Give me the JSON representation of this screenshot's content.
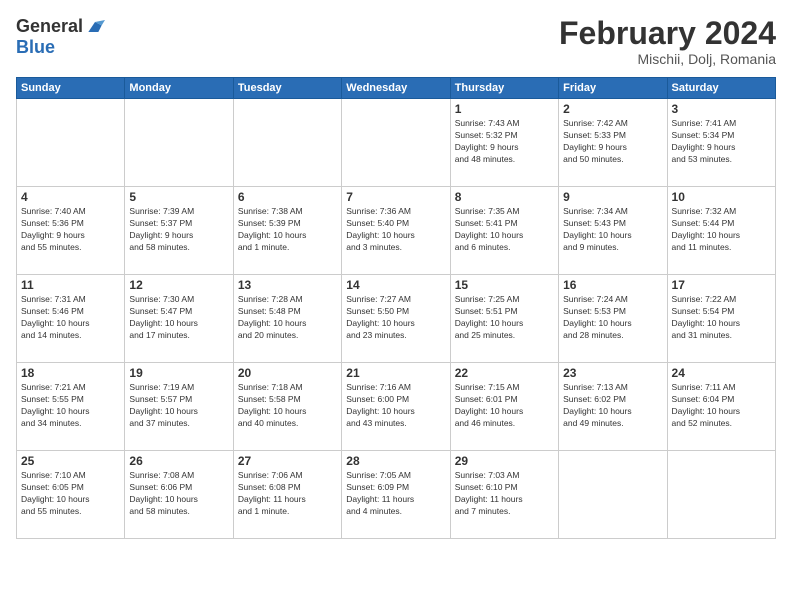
{
  "header": {
    "logo_general": "General",
    "logo_blue": "Blue",
    "title": "February 2024",
    "location": "Mischii, Dolj, Romania"
  },
  "weekdays": [
    "Sunday",
    "Monday",
    "Tuesday",
    "Wednesday",
    "Thursday",
    "Friday",
    "Saturday"
  ],
  "weeks": [
    [
      {
        "day": "",
        "info": ""
      },
      {
        "day": "",
        "info": ""
      },
      {
        "day": "",
        "info": ""
      },
      {
        "day": "",
        "info": ""
      },
      {
        "day": "1",
        "info": "Sunrise: 7:43 AM\nSunset: 5:32 PM\nDaylight: 9 hours\nand 48 minutes."
      },
      {
        "day": "2",
        "info": "Sunrise: 7:42 AM\nSunset: 5:33 PM\nDaylight: 9 hours\nand 50 minutes."
      },
      {
        "day": "3",
        "info": "Sunrise: 7:41 AM\nSunset: 5:34 PM\nDaylight: 9 hours\nand 53 minutes."
      }
    ],
    [
      {
        "day": "4",
        "info": "Sunrise: 7:40 AM\nSunset: 5:36 PM\nDaylight: 9 hours\nand 55 minutes."
      },
      {
        "day": "5",
        "info": "Sunrise: 7:39 AM\nSunset: 5:37 PM\nDaylight: 9 hours\nand 58 minutes."
      },
      {
        "day": "6",
        "info": "Sunrise: 7:38 AM\nSunset: 5:39 PM\nDaylight: 10 hours\nand 1 minute."
      },
      {
        "day": "7",
        "info": "Sunrise: 7:36 AM\nSunset: 5:40 PM\nDaylight: 10 hours\nand 3 minutes."
      },
      {
        "day": "8",
        "info": "Sunrise: 7:35 AM\nSunset: 5:41 PM\nDaylight: 10 hours\nand 6 minutes."
      },
      {
        "day": "9",
        "info": "Sunrise: 7:34 AM\nSunset: 5:43 PM\nDaylight: 10 hours\nand 9 minutes."
      },
      {
        "day": "10",
        "info": "Sunrise: 7:32 AM\nSunset: 5:44 PM\nDaylight: 10 hours\nand 11 minutes."
      }
    ],
    [
      {
        "day": "11",
        "info": "Sunrise: 7:31 AM\nSunset: 5:46 PM\nDaylight: 10 hours\nand 14 minutes."
      },
      {
        "day": "12",
        "info": "Sunrise: 7:30 AM\nSunset: 5:47 PM\nDaylight: 10 hours\nand 17 minutes."
      },
      {
        "day": "13",
        "info": "Sunrise: 7:28 AM\nSunset: 5:48 PM\nDaylight: 10 hours\nand 20 minutes."
      },
      {
        "day": "14",
        "info": "Sunrise: 7:27 AM\nSunset: 5:50 PM\nDaylight: 10 hours\nand 23 minutes."
      },
      {
        "day": "15",
        "info": "Sunrise: 7:25 AM\nSunset: 5:51 PM\nDaylight: 10 hours\nand 25 minutes."
      },
      {
        "day": "16",
        "info": "Sunrise: 7:24 AM\nSunset: 5:53 PM\nDaylight: 10 hours\nand 28 minutes."
      },
      {
        "day": "17",
        "info": "Sunrise: 7:22 AM\nSunset: 5:54 PM\nDaylight: 10 hours\nand 31 minutes."
      }
    ],
    [
      {
        "day": "18",
        "info": "Sunrise: 7:21 AM\nSunset: 5:55 PM\nDaylight: 10 hours\nand 34 minutes."
      },
      {
        "day": "19",
        "info": "Sunrise: 7:19 AM\nSunset: 5:57 PM\nDaylight: 10 hours\nand 37 minutes."
      },
      {
        "day": "20",
        "info": "Sunrise: 7:18 AM\nSunset: 5:58 PM\nDaylight: 10 hours\nand 40 minutes."
      },
      {
        "day": "21",
        "info": "Sunrise: 7:16 AM\nSunset: 6:00 PM\nDaylight: 10 hours\nand 43 minutes."
      },
      {
        "day": "22",
        "info": "Sunrise: 7:15 AM\nSunset: 6:01 PM\nDaylight: 10 hours\nand 46 minutes."
      },
      {
        "day": "23",
        "info": "Sunrise: 7:13 AM\nSunset: 6:02 PM\nDaylight: 10 hours\nand 49 minutes."
      },
      {
        "day": "24",
        "info": "Sunrise: 7:11 AM\nSunset: 6:04 PM\nDaylight: 10 hours\nand 52 minutes."
      }
    ],
    [
      {
        "day": "25",
        "info": "Sunrise: 7:10 AM\nSunset: 6:05 PM\nDaylight: 10 hours\nand 55 minutes."
      },
      {
        "day": "26",
        "info": "Sunrise: 7:08 AM\nSunset: 6:06 PM\nDaylight: 10 hours\nand 58 minutes."
      },
      {
        "day": "27",
        "info": "Sunrise: 7:06 AM\nSunset: 6:08 PM\nDaylight: 11 hours\nand 1 minute."
      },
      {
        "day": "28",
        "info": "Sunrise: 7:05 AM\nSunset: 6:09 PM\nDaylight: 11 hours\nand 4 minutes."
      },
      {
        "day": "29",
        "info": "Sunrise: 7:03 AM\nSunset: 6:10 PM\nDaylight: 11 hours\nand 7 minutes."
      },
      {
        "day": "",
        "info": ""
      },
      {
        "day": "",
        "info": ""
      }
    ]
  ]
}
